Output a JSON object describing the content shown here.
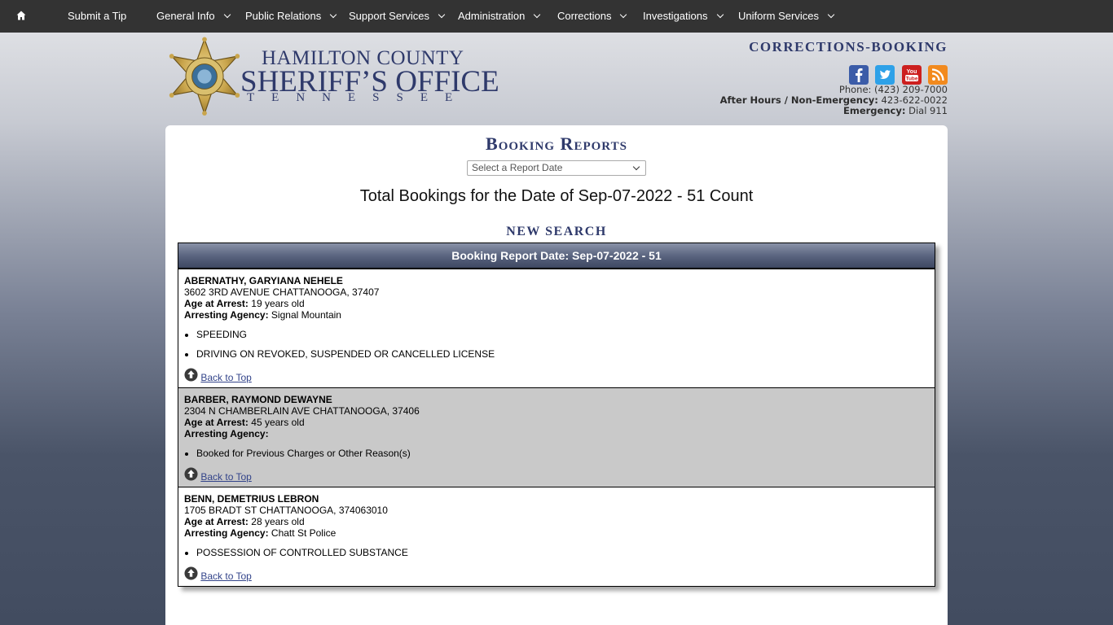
{
  "nav": {
    "items": [
      {
        "label": "Submit a Tip",
        "dropdown": false
      },
      {
        "label": "General Info",
        "dropdown": true
      },
      {
        "label": "Public Relations",
        "dropdown": true
      },
      {
        "label": "Support Services",
        "dropdown": true
      },
      {
        "label": "Administration",
        "dropdown": true
      },
      {
        "label": "Corrections",
        "dropdown": true
      },
      {
        "label": "Investigations",
        "dropdown": true
      },
      {
        "label": "Uniform Services",
        "dropdown": true
      }
    ],
    "home_icon": "home-icon"
  },
  "header": {
    "county": "HAMILTON COUNTY",
    "office": "SHERIFF’S OFFICE",
    "state": "TENNESSEE",
    "dept": "Corrections-Booking",
    "social_icons": [
      "facebook-icon",
      "twitter-icon",
      "youtube-icon",
      "rss-icon"
    ],
    "phone_label": "Phone:",
    "phone": "(423) 209-7000",
    "after_hours_label": "After Hours / Non-Emergency:",
    "after_hours": "423-622-0022",
    "emergency_label": "Emergency:",
    "emergency": "Dial 911"
  },
  "main": {
    "title": "Booking Reports",
    "select_placeholder": "Select a Report Date",
    "total_line": "Total Bookings for the Date of Sep-07-2022 - 51 Count",
    "new_search": "New Search",
    "report_header": "Booking Report Date: Sep-07-2022 - 51",
    "back_to_top": "Back to Top",
    "age_label": "Age at Arrest:",
    "agency_label": "Arresting Agency:",
    "records": [
      {
        "name": "ABERNATHY, GARYIANA NEHELE",
        "address": "3602 3RD AVENUE CHATTANOOGA, 37407",
        "age": "19 years old",
        "agency": "Signal Mountain",
        "charges": [
          "SPEEDING",
          "DRIVING ON REVOKED, SUSPENDED OR CANCELLED LICENSE"
        ]
      },
      {
        "name": "BARBER, RAYMOND DEWAYNE",
        "address": "2304 N CHAMBERLAIN AVE CHATTANOOGA, 37406",
        "age": "45 years old",
        "agency": "",
        "charges": [
          "Booked for Previous Charges or Other Reason(s)"
        ]
      },
      {
        "name": "BENN, DEMETRIUS LEBRON",
        "address": "1705 BRADT ST CHATTANOOGA, 374063010",
        "age": "28 years old",
        "agency": "Chatt St Police",
        "charges": [
          "POSSESSION OF CONTROLLED SUBSTANCE"
        ]
      }
    ]
  },
  "colors": {
    "nav_bg": "#333333",
    "brand_navy": "#2f3a6b",
    "alt_row": "#c9c9c9"
  }
}
